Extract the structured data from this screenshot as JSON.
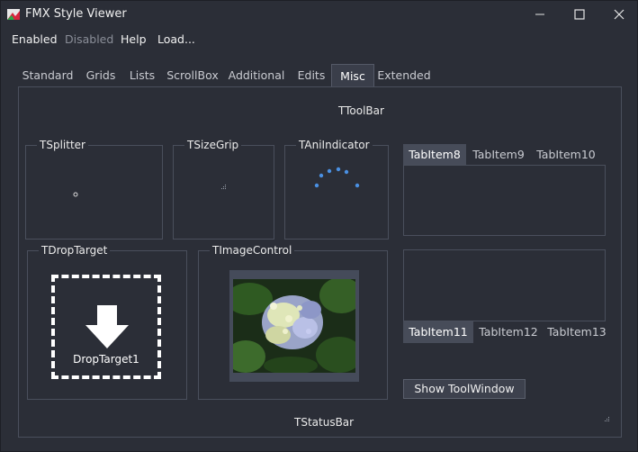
{
  "window": {
    "title": "FMX Style Viewer"
  },
  "menu": [
    {
      "label": "Enabled",
      "disabled": false
    },
    {
      "label": "Disabled",
      "disabled": true
    },
    {
      "label": "Help",
      "disabled": false
    },
    {
      "label": "Load...",
      "disabled": false
    }
  ],
  "tabs": [
    "Standard",
    "Grids",
    "Lists",
    "ScrollBox",
    "Additional",
    "Edits",
    "Misc",
    "Extended"
  ],
  "active_tab": "Misc",
  "content": {
    "toolbar_label": "TToolBar",
    "splitter_title": "TSplitter",
    "sizegrip_title": "TSizeGrip",
    "aniindicator_title": "TAniIndicator",
    "droptarget_title": "TDropTarget",
    "droptarget_caption": "DropTarget1",
    "imagecontrol_title": "TImageControl",
    "statusbar_label": "TStatusBar",
    "show_toolwindow": "Show ToolWindow",
    "tabcontrol_top": [
      "TabItem8",
      "TabItem9",
      "TabItem10"
    ],
    "tabcontrol_bottom": [
      "TabItem11",
      "TabItem12",
      "TabItem13"
    ]
  },
  "colors": {
    "background": "#2b2e37",
    "accent": "#4a90e2",
    "border": "#4a4f5c"
  }
}
